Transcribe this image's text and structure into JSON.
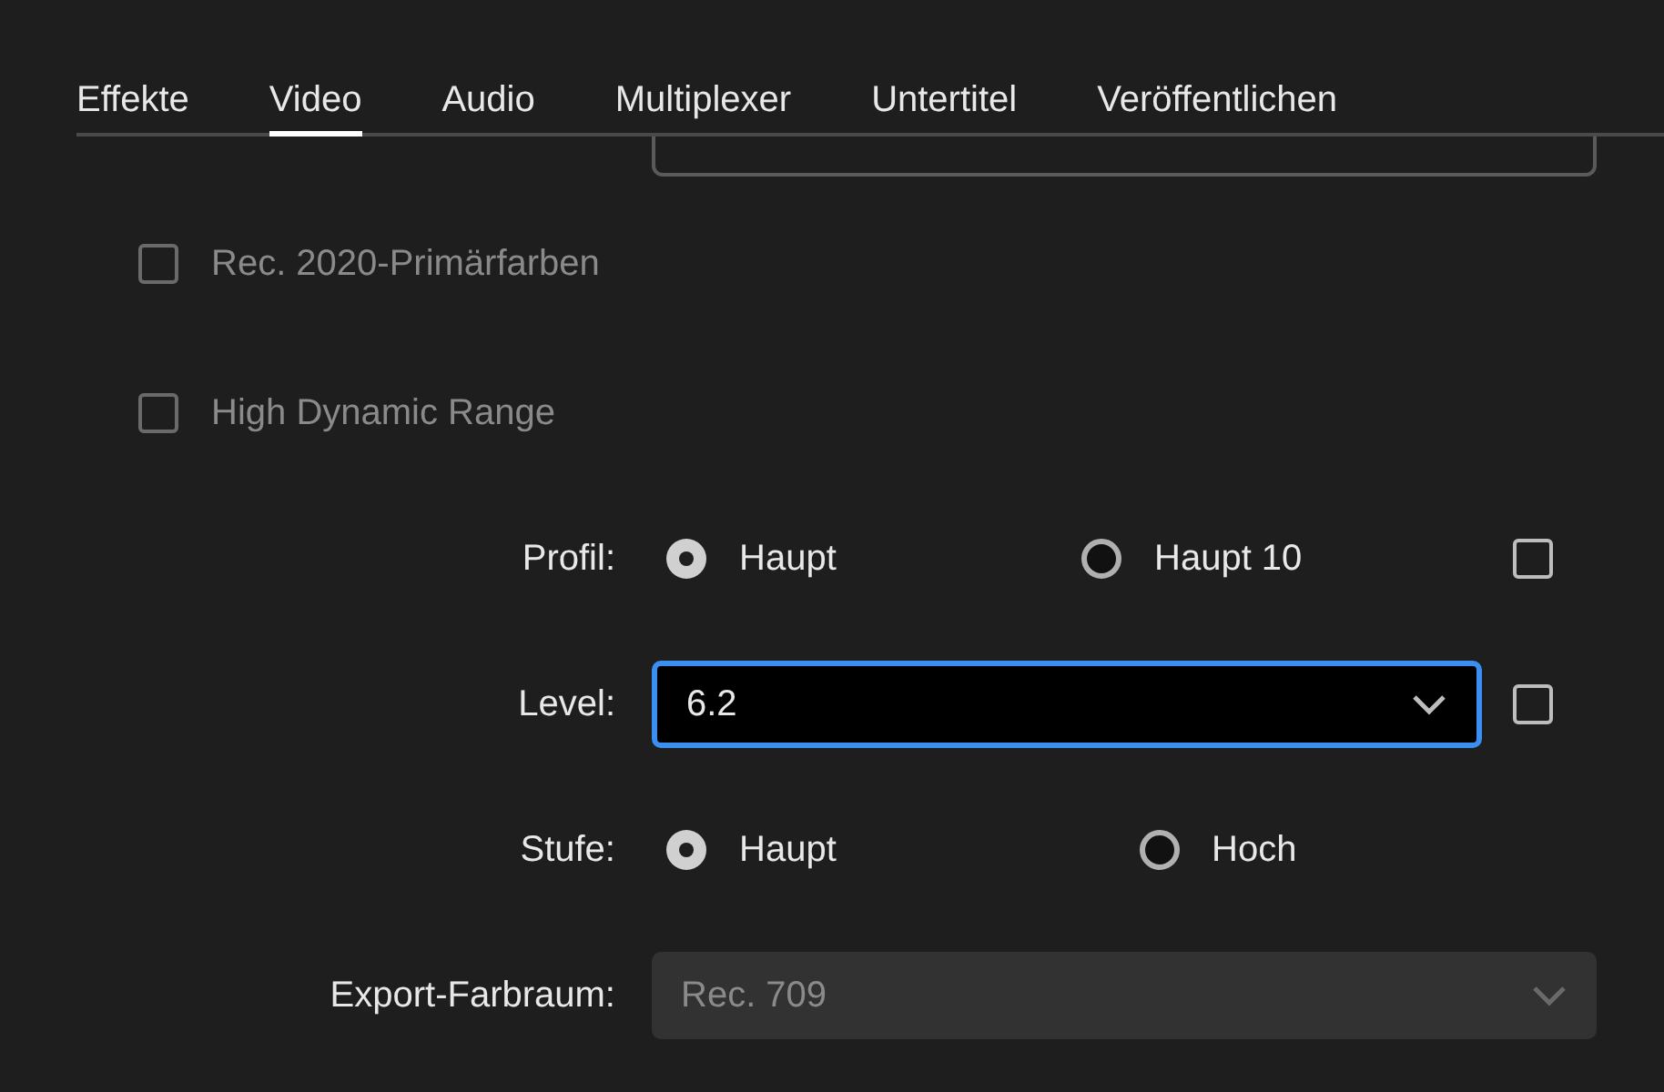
{
  "tabs": [
    {
      "label": "Effekte",
      "selected": false
    },
    {
      "label": "Video",
      "selected": true
    },
    {
      "label": "Audio",
      "selected": false
    },
    {
      "label": "Multiplexer",
      "selected": false
    },
    {
      "label": "Untertitel",
      "selected": false
    },
    {
      "label": "Veröffentlichen",
      "selected": false
    }
  ],
  "options": [
    {
      "label": "Rec. 2020-Primärfarben",
      "checked": false,
      "disabled": true
    },
    {
      "label": "High Dynamic Range",
      "checked": false,
      "disabled": true
    }
  ],
  "form": [
    {
      "kind": "radio",
      "label": "Profil:",
      "choices": [
        {
          "label": "Haupt",
          "selected": true
        },
        {
          "label": "Haupt 10",
          "selected": false
        }
      ],
      "checkbox": {
        "checked": false
      }
    },
    {
      "kind": "dropdown",
      "label": "Level:",
      "value": "6.2",
      "focused": true,
      "disabled": false,
      "checkbox": {
        "checked": false
      }
    },
    {
      "kind": "radio",
      "label": "Stufe:",
      "choices": [
        {
          "label": "Haupt",
          "selected": true
        },
        {
          "label": "Hoch",
          "selected": false
        }
      ]
    },
    {
      "kind": "dropdown",
      "label": "Export-Farbraum:",
      "value": "Rec. 709",
      "focused": false,
      "disabled": true
    }
  ]
}
